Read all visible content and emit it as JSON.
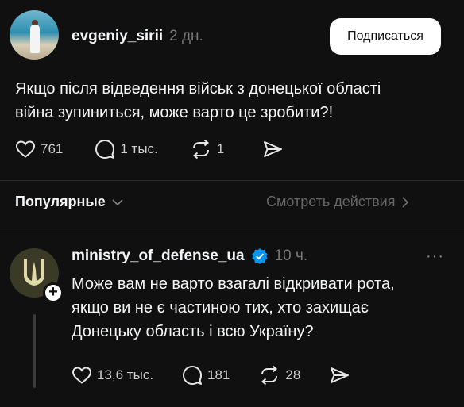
{
  "post": {
    "username": "evgeniy_sirii",
    "time": "2 дн.",
    "follow_label": "Подписаться",
    "text_line1": "Якщо після відведення військ з донецької області",
    "text_line2": "війна зупиниться, може варто це зробити?!",
    "likes": "761",
    "replies": "1 тыс.",
    "reposts": "1"
  },
  "section": {
    "title": "Популярные",
    "link": "Смотреть действия"
  },
  "reply": {
    "username": "ministry_of_defense_ua",
    "time": "10 ч.",
    "more": "···",
    "text_line1": "Може вам не варто взагалі відкривати рота,",
    "text_line2": "якщо ви не є частиною тих, хто захищає",
    "text_line3": "Донецьку область і всю Україну?",
    "likes": "13,6 тыс.",
    "replies": "181",
    "reposts": "28"
  },
  "colors": {
    "background": "#101010",
    "text": "#f3f5f7",
    "muted": "#777777",
    "verified": "#0095f6",
    "avatar2_bg": "#3a3a26",
    "emblem": "#e0d9a8"
  }
}
